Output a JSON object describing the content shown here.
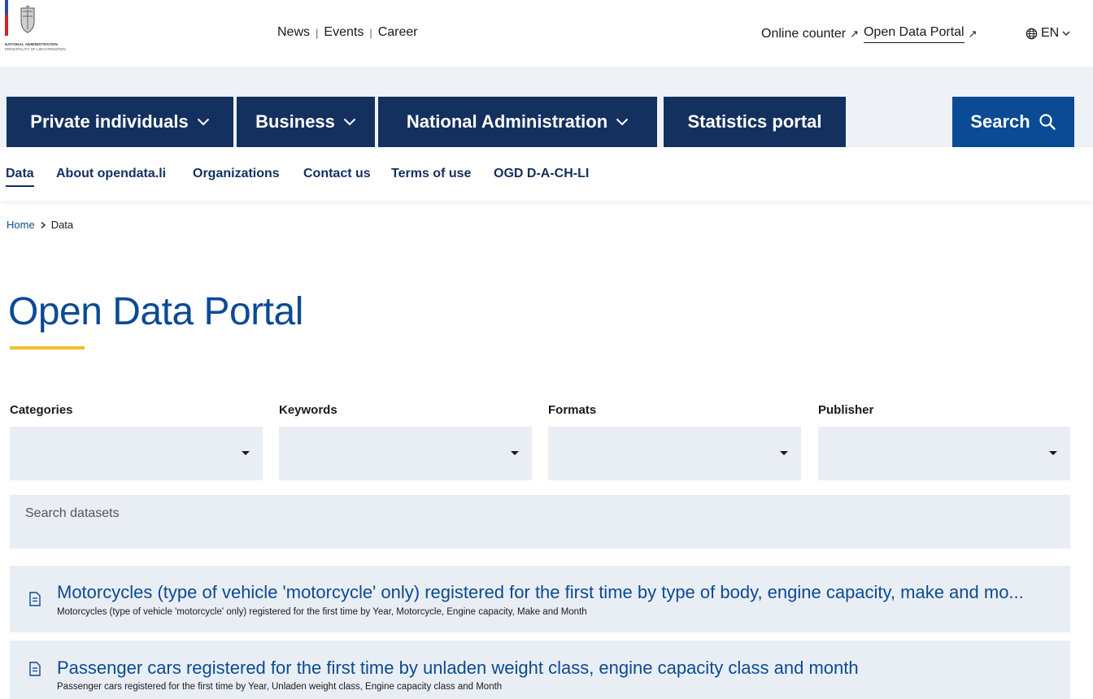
{
  "header": {
    "logo": {
      "line1": "NATIONAL ADMINISTRATION",
      "line2": "PRINCIPALITY OF LIECHTENSTEIN"
    },
    "top_links": [
      "News",
      "Events",
      "Career"
    ],
    "right_links": {
      "online_counter": "Online counter",
      "open_data_portal": "Open Data Portal"
    },
    "language": "EN"
  },
  "main_nav": {
    "items": [
      {
        "label": "Private individuals",
        "has_dropdown": true
      },
      {
        "label": "Business",
        "has_dropdown": true
      },
      {
        "label": "National Administration",
        "has_dropdown": true
      },
      {
        "label": "Statistics portal",
        "has_dropdown": false
      }
    ],
    "search_label": "Search"
  },
  "sub_nav": {
    "items": [
      "Data",
      "About opendata.li",
      "Organizations",
      "Contact us",
      "Terms of use",
      "OGD D-A-CH-LI"
    ],
    "active": "Data"
  },
  "breadcrumb": {
    "home": "Home",
    "current": "Data"
  },
  "page": {
    "title": "Open Data Portal"
  },
  "filters": {
    "categories_label": "Categories",
    "keywords_label": "Keywords",
    "formats_label": "Formats",
    "publisher_label": "Publisher",
    "search_placeholder": "Search datasets"
  },
  "results": [
    {
      "title": "Motorcycles (type of vehicle 'motorcycle' only) registered for the first time by type of body, engine capacity, make and mo...",
      "description": "Motorcycles (type of vehicle 'motorcycle' only) registered for the first time by Year, Motorcycle, Engine capacity, Make and Month"
    },
    {
      "title": "Passenger cars registered for the first time by unladen weight class, engine capacity class and month",
      "description": "Passenger cars registered for the first time by Year, Unladen weight class, Engine capacity class and Month"
    }
  ],
  "colors": {
    "navy": "#14305f",
    "accent_blue": "#0b4a94",
    "yellow": "#f3c12f",
    "field_bg": "#e9eef5"
  }
}
